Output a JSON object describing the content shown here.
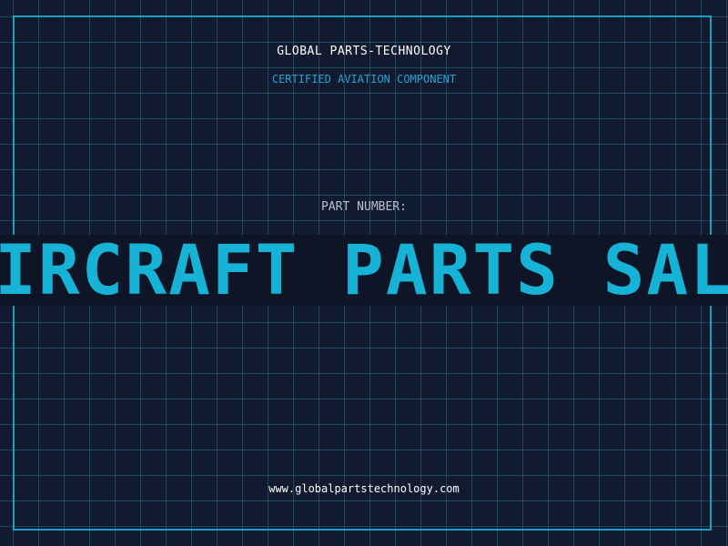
{
  "header": {
    "company": "GLOBAL PARTS-TECHNOLOGY",
    "tagline": "CERTIFIED AVIATION COMPONENT"
  },
  "part": {
    "label": "PART NUMBER:",
    "value": "AIRCRAFT PARTS SALE"
  },
  "footer": {
    "url": "www.globalpartstechnology.com"
  },
  "colors": {
    "background": "#111a2e",
    "grid": "#216e8c",
    "frame": "#1d9fc4",
    "accent": "#16b3d6",
    "text_primary": "#ffffff",
    "text_muted": "#b9c2d0"
  }
}
